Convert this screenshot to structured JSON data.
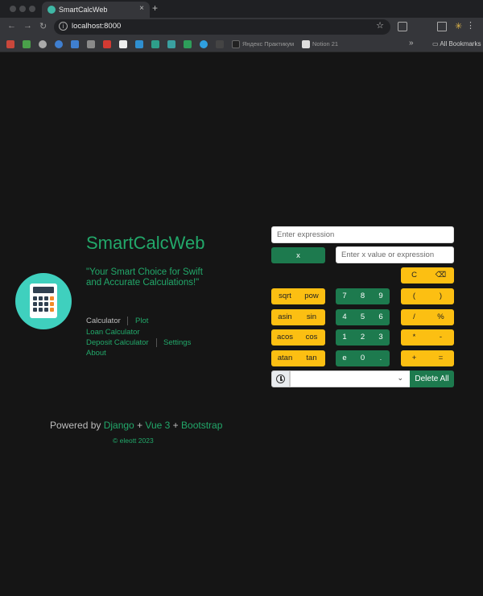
{
  "browser": {
    "tab_title": "SmartCalcWeb",
    "tab_close": "×",
    "new_tab": "+",
    "url": "localhost:8000",
    "bookmarks": [
      {
        "label": "Яндекс Практикум"
      },
      {
        "label": "Notion 21"
      }
    ],
    "bookmarks_more": "»",
    "all_bookmarks": "All Bookmarks"
  },
  "header": {
    "title": "SmartCalcWeb",
    "tagline": "\"Your Smart Choice for Swift and Accurate Calculations!\""
  },
  "nav": {
    "calculator": "Calculator",
    "plot": "Plot",
    "loan": "Loan Calculator",
    "deposit": "Deposit Calculator",
    "settings": "Settings",
    "about": "About"
  },
  "footer": {
    "powered_prefix": "Powered by ",
    "django": "Django",
    "plus1": " + ",
    "vue": "Vue 3",
    "plus2": " + ",
    "bootstrap": "Bootstrap",
    "copyright": "© eleott 2023"
  },
  "calculator": {
    "expression_placeholder": "Enter expression",
    "x_button": "x",
    "x_placeholder": "Enter x value or expression",
    "clear": "C",
    "backspace": "⌫",
    "func_rows": [
      [
        "sqrt",
        "pow"
      ],
      [
        "asin",
        "sin"
      ],
      [
        "acos",
        "cos"
      ],
      [
        "atan",
        "tan"
      ]
    ],
    "digit_rows": [
      [
        "7",
        "8",
        "9"
      ],
      [
        "4",
        "5",
        "6"
      ],
      [
        "1",
        "2",
        "3"
      ],
      [
        "e",
        "0",
        "."
      ]
    ],
    "op_rows": [
      [
        "(",
        ")"
      ],
      [
        "/",
        "%"
      ],
      [
        "*",
        "-"
      ],
      [
        "+",
        "="
      ]
    ],
    "history_value": "",
    "delete_all": "Delete All"
  },
  "colors": {
    "accent": "#22a86a",
    "button_green": "#1d7a4e",
    "button_yellow": "#fcbf12",
    "background": "#151515"
  }
}
